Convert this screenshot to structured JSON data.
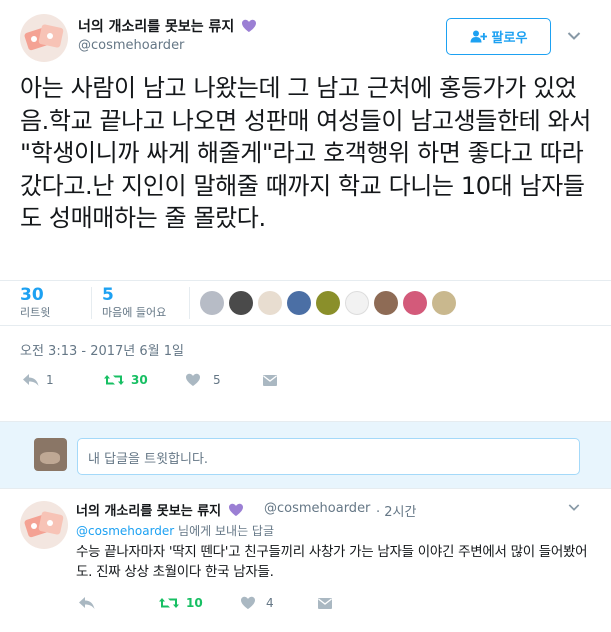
{
  "colors": {
    "accent": "#1da1f2",
    "retweet_green": "#17bf63",
    "muted": "#657786",
    "heart_purple": "#9b7fd4"
  },
  "tweet": {
    "display_name": "너의 개소리를 못보는 류지",
    "handle": "@cosmehoarder",
    "follow_label": "팔로우",
    "text": "아는 사람이 남고 나왔는데 그 남고 근처에 홍등가가 있었음.학교 끝나고 나오면 성판매 여성들이 남고생들한테 와서 \"학생이니까 싸게 해줄게\"라고 호객행위 하면 좋다고 따라갔다고.난 지인이 말해줄 때까지 학교 다니는 10대 남자들도 성매매하는 줄 몰랐다.",
    "retweets_count": "30",
    "retweets_label": "리트윗",
    "likes_count": "5",
    "likes_label": "마음에 들어요",
    "timestamp": "오전 3:13 - 2017년 6월 1일",
    "actions": {
      "reply_count": "1",
      "retweet_count": "30",
      "like_count": "5"
    }
  },
  "reply_box": {
    "placeholder": "내 답글을 트윗합니다."
  },
  "reply": {
    "display_name": "너의 개소리를 못보는 류지",
    "handle": "@cosmehoarder",
    "time": "· 2시간",
    "reply_to_handle": "@cosmehoarder",
    "reply_to_suffix": " 님에게 보내는 답글",
    "text": "수능 끝나자마자 '딱지 뗀다'고 친구들끼리 사창가 가는 남자들 이야긴 주변에서 많이 들어봤어도. 진짜 상상 초월이다 한국 남자들.",
    "actions": {
      "retweet_count": "10",
      "like_count": "4"
    }
  }
}
